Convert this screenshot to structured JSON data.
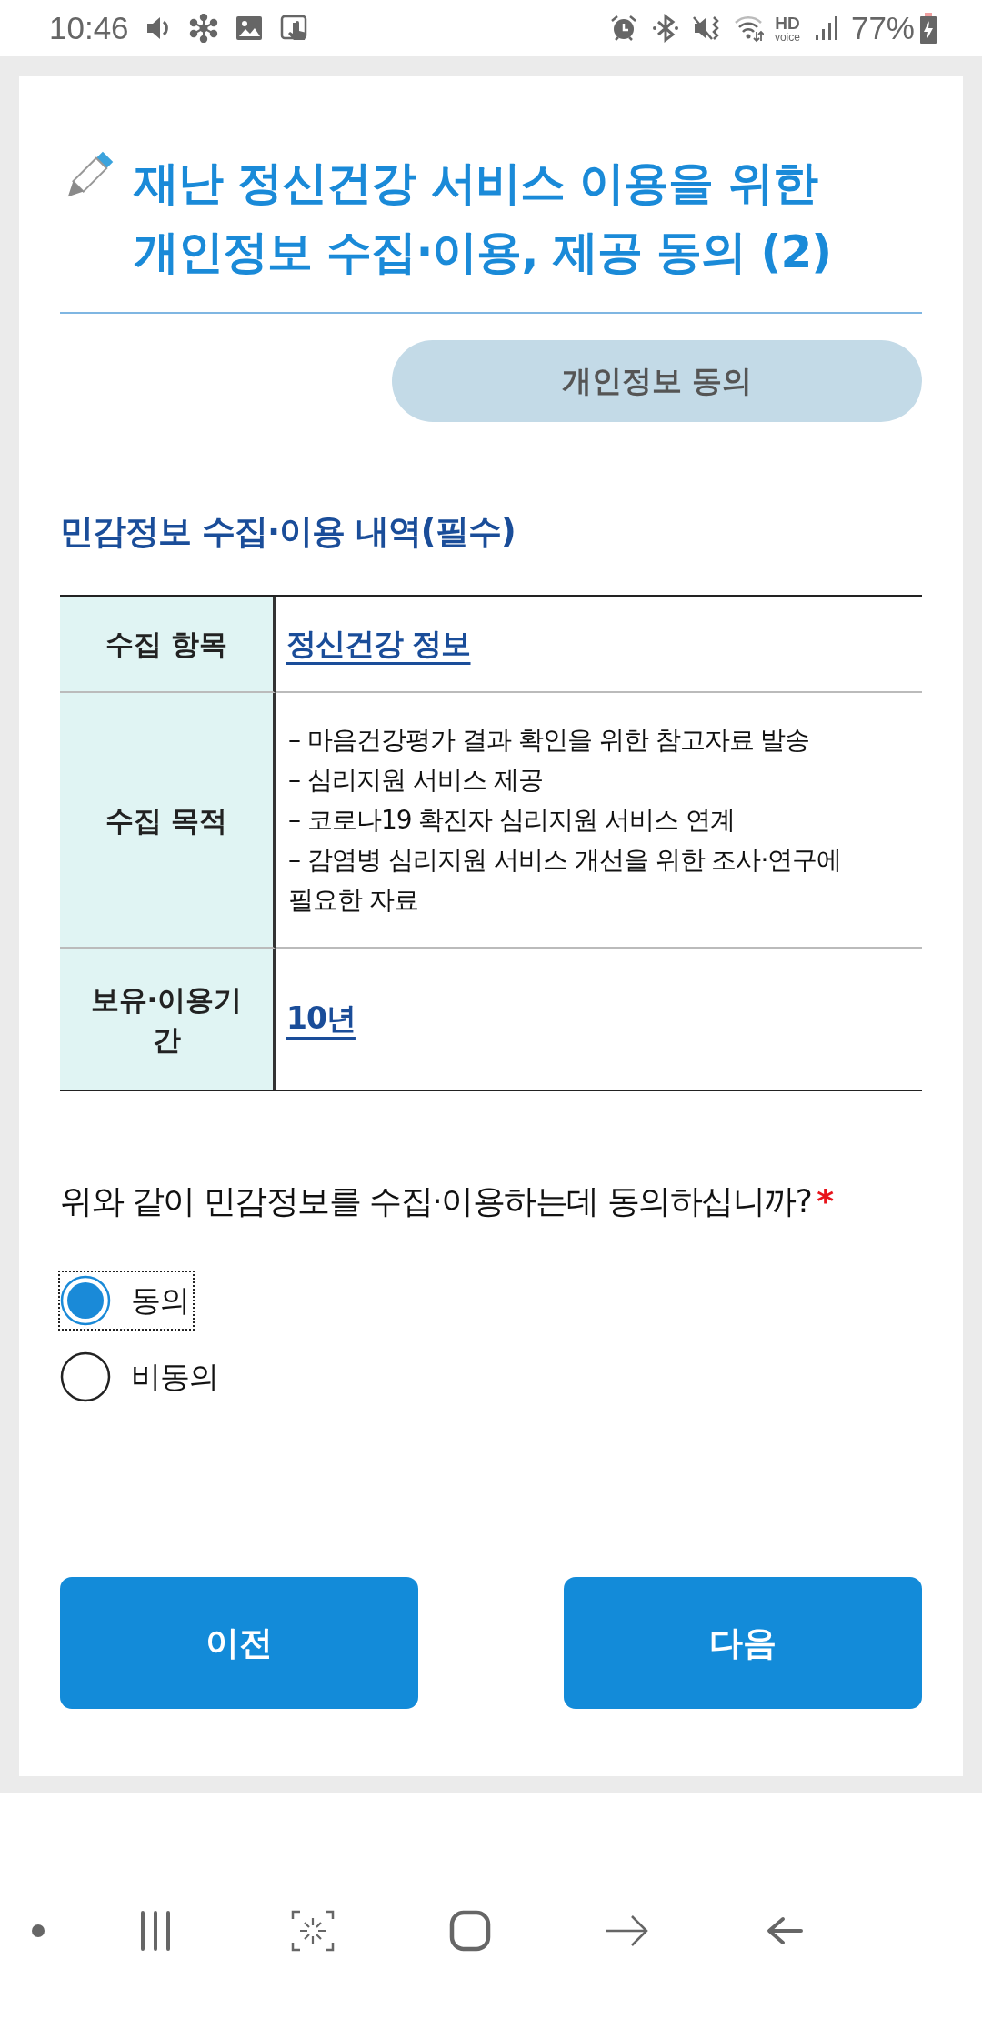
{
  "status_bar": {
    "time": "10:46",
    "hd": "HD",
    "voice": "voice",
    "battery": "77%"
  },
  "header": {
    "title": "재난 정신건강 서비스 이용을 위한 개인정보 수집·이용, 제공 동의 (2)",
    "tag": "개인정보 동의"
  },
  "section": {
    "heading": "민감정보 수집·이용 내역(필수)",
    "rows": [
      {
        "label": "수집 항목",
        "kind": "link",
        "value": "정신건강 정보"
      },
      {
        "label": "수집 목적",
        "kind": "list",
        "lines": [
          "– 마음건강평가 결과 확인을 위한 참고자료 발송",
          "– 심리지원 서비스 제공",
          "– 코로나19 확진자 심리지원 서비스 연계",
          "– 감염병 심리지원 서비스 개선을 위한 조사·연구에 필요한 자료"
        ]
      },
      {
        "label": "보유·이용기간",
        "kind": "link",
        "value": "10년"
      }
    ]
  },
  "question": {
    "text": "위와 같이 민감정보를 수집·이용하는데 동의하십니까?",
    "required_mark": "*",
    "options": [
      {
        "label": "동의",
        "selected": true,
        "focused": true
      },
      {
        "label": "비동의",
        "selected": false,
        "focused": false
      }
    ]
  },
  "buttons": [
    {
      "label": "이전"
    },
    {
      "label": "다음"
    }
  ]
}
